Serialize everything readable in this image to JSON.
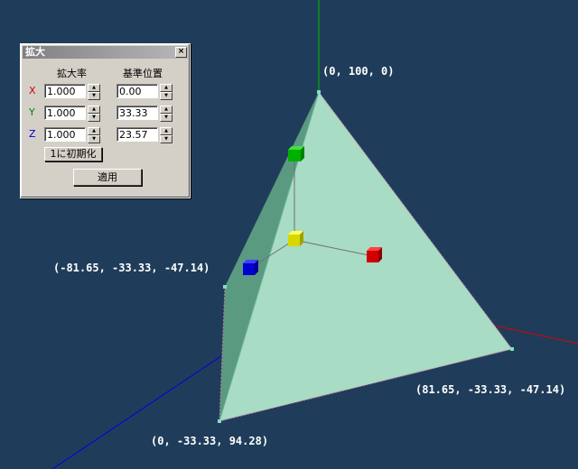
{
  "dialog": {
    "title": "拡大",
    "close_glyph": "×",
    "col_scale": "拡大率",
    "col_base": "基準位置",
    "rows": [
      {
        "axis": "X",
        "axis_color": "#cc0000",
        "scale": "1.000",
        "base": "0.00"
      },
      {
        "axis": "Y",
        "axis_color": "#008000",
        "scale": "1.000",
        "base": "33.33"
      },
      {
        "axis": "Z",
        "axis_color": "#0000cc",
        "scale": "1.000",
        "base": "23.57"
      }
    ],
    "reset_label": "1に初期化",
    "apply_label": "適用"
  },
  "viewport": {
    "background": "#1f3d5a",
    "face_color": "#a8dcc4",
    "vertex_labels": {
      "top": "(0, 100, 0)",
      "left": "(-81.65, -33.33, -47.14)",
      "right": "(81.65, -33.33, -47.14)",
      "bottom": "(0, -33.33, 94.28)"
    },
    "gizmo_colors": {
      "x": "#e00000",
      "y": "#00cc00",
      "z": "#0000dd",
      "center": "#e8e800"
    }
  }
}
